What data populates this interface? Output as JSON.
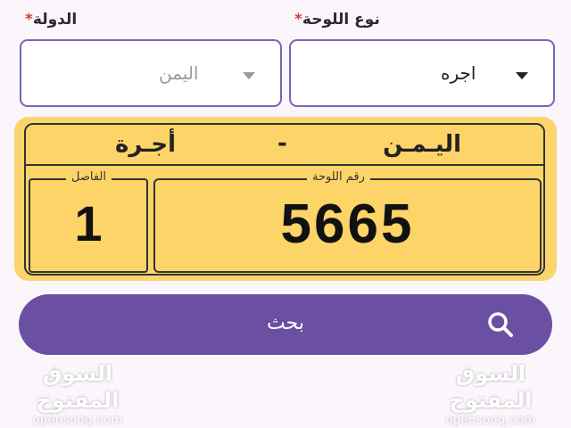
{
  "form": {
    "plate_type": {
      "label": "نوع اللوحة",
      "required_mark": "*",
      "value": "اجره"
    },
    "country": {
      "label": "الدولة",
      "required_mark": "*",
      "value": "اليمن"
    }
  },
  "plate": {
    "country": "اليـمـن",
    "separator": "-",
    "type": "أجـرة",
    "divider_label": "الفاصل",
    "divider_value": "1",
    "number_label": "رقم اللوحة",
    "number_value": "5665"
  },
  "search": {
    "label": "بحث",
    "icon": "search-icon"
  },
  "watermark": {
    "arabic": "السوق المفتوح",
    "latin": "opensooq.com"
  },
  "colors": {
    "accent": "#6a4fa3",
    "plate_yellow": "#fdd468",
    "required": "#d93a3a"
  }
}
